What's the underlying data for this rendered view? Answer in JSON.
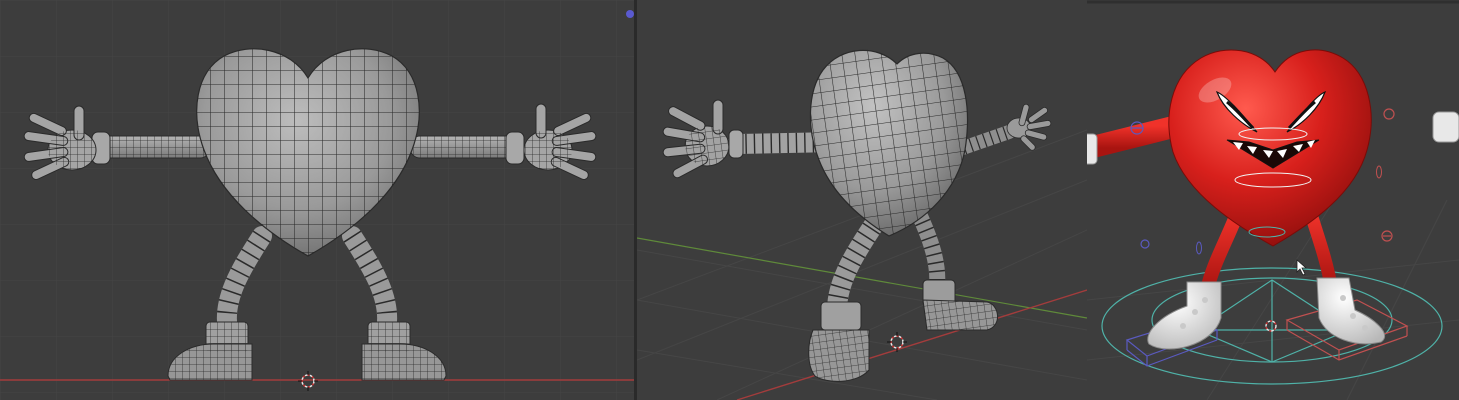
{
  "viewports": [
    {
      "view": "front-orthographic",
      "shading": "solid-wireframe",
      "object": "heart-character"
    },
    {
      "view": "three-quarter-perspective",
      "shading": "solid-wireframe",
      "object": "heart-character"
    },
    {
      "view": "perspective",
      "shading": "textured-rigged",
      "object": "heart-character"
    }
  ],
  "colors": {
    "viewport_background": "#3d3d3d",
    "grid_line": "#444444",
    "x_axis": "#a33c3c",
    "y_axis": "#5f8a3a",
    "mesh_body": "#9c9c9c",
    "wire": "#2a2a2a",
    "textured_body": "#d8201c",
    "shoe": "#e8e8e8",
    "rig_control": "#4fb2a8",
    "bone_box_left": "#5a5ac0",
    "bone_box_right": "#c05050"
  },
  "icons": [
    "3d-cursor-icon",
    "mouse-pointer-icon",
    "bone-control-icon"
  ]
}
